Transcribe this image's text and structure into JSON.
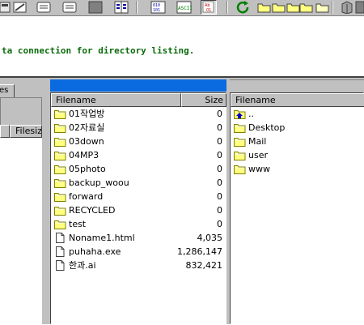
{
  "toolbar": {
    "buttons": [
      {
        "name": "connect-icon"
      },
      {
        "name": "properties-icon"
      },
      {
        "name": "message-icon"
      },
      {
        "name": "message-icon"
      },
      {
        "name": "blank-icon"
      },
      {
        "name": "compare-icon"
      },
      {
        "name": "binary-mode-icon"
      },
      {
        "name": "ascii-mode-icon"
      },
      {
        "name": "auto-mode-icon"
      },
      {
        "name": "refresh-icon"
      },
      {
        "name": "folder-icon"
      },
      {
        "name": "folder-icon"
      },
      {
        "name": "folder-icon"
      },
      {
        "name": "folder-icon"
      },
      {
        "name": "trash-icon"
      }
    ]
  },
  "log": {
    "line": "ta connection for directory listing."
  },
  "left_pane": {
    "tab_label": "es",
    "col_filesize": "Filesiz"
  },
  "local_pane": {
    "col_filename": "Filename",
    "col_size": "Size",
    "title_color": "#0a6ae0",
    "files": [
      {
        "name": "01작업방",
        "size": "0",
        "icon": "folder-icon"
      },
      {
        "name": "02자료실",
        "size": "0",
        "icon": "folder-icon"
      },
      {
        "name": "03down",
        "size": "0",
        "icon": "folder-icon"
      },
      {
        "name": "04MP3",
        "size": "0",
        "icon": "folder-icon"
      },
      {
        "name": "05photo",
        "size": "0",
        "icon": "folder-icon"
      },
      {
        "name": "backup_woou",
        "size": "0",
        "icon": "folder-icon"
      },
      {
        "name": "forward",
        "size": "0",
        "icon": "folder-icon"
      },
      {
        "name": "RECYCLED",
        "size": "0",
        "icon": "folder-icon"
      },
      {
        "name": "test",
        "size": "0",
        "icon": "folder-icon"
      },
      {
        "name": "Noname1.html",
        "size": "4,035",
        "icon": "file-icon"
      },
      {
        "name": "puhaha.exe",
        "size": "1,286,147",
        "icon": "file-icon"
      },
      {
        "name": "한과.ai",
        "size": "832,421",
        "icon": "file-icon"
      }
    ]
  },
  "remote_pane": {
    "col_filename": "Filename",
    "files": [
      {
        "name": "..",
        "icon": "parent-folder-icon"
      },
      {
        "name": "Desktop",
        "icon": "folder-icon"
      },
      {
        "name": "Mail",
        "icon": "folder-icon"
      },
      {
        "name": "user",
        "icon": "folder-icon"
      },
      {
        "name": "www",
        "icon": "folder-icon"
      }
    ]
  }
}
